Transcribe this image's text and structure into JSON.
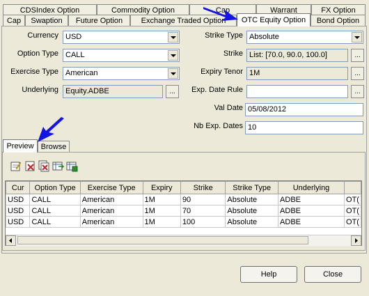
{
  "tabs_row1": [
    "CDSIndex Option",
    "Commodity Option",
    "Cap",
    "Warrant",
    "FX Option"
  ],
  "tabs_row2": [
    "Cap",
    "Swaption",
    "Future Option",
    "Exchange Traded Option",
    "OTC Equity Option",
    "Bond Option"
  ],
  "form": {
    "currency_label": "Currency",
    "currency_value": "USD",
    "option_type_label": "Option Type",
    "option_type_value": "CALL",
    "exercise_type_label": "Exercise Type",
    "exercise_type_value": "American",
    "underlying_label": "Underlying",
    "underlying_value": "Equity.ADBE",
    "strike_type_label": "Strike Type",
    "strike_type_value": "Absolute",
    "strike_label": "Strike",
    "strike_value": "List: [70.0, 90.0, 100.0]",
    "expiry_tenor_label": "Expiry Tenor",
    "expiry_tenor_value": "1M",
    "exp_date_rule_label": "Exp. Date Rule",
    "exp_date_rule_value": "",
    "val_date_label": "Val Date",
    "val_date_value": "05/08/2012",
    "nb_exp_dates_label": "Nb Exp. Dates",
    "nb_exp_dates_value": "10",
    "ellipsis": "..."
  },
  "lower_tabs": [
    "Preview",
    "Browse"
  ],
  "table": {
    "columns": [
      "Cur",
      "Option Type",
      "Exercise Type",
      "Expiry",
      "Strike",
      "Strike Type",
      "Underlying",
      ""
    ],
    "rows": [
      [
        "USD",
        "CALL",
        "American",
        "1M",
        "90",
        "Absolute",
        "ADBE",
        "OT("
      ],
      [
        "USD",
        "CALL",
        "American",
        "1M",
        "70",
        "Absolute",
        "ADBE",
        "OT("
      ],
      [
        "USD",
        "CALL",
        "American",
        "1M",
        "100",
        "Absolute",
        "ADBE",
        "OT("
      ]
    ]
  },
  "buttons": {
    "help": "Help",
    "close": "Close"
  },
  "colors": {
    "annotation_arrow": "#1414e6",
    "icon_green": "#2e8b2e",
    "icon_red": "#cc2222"
  }
}
